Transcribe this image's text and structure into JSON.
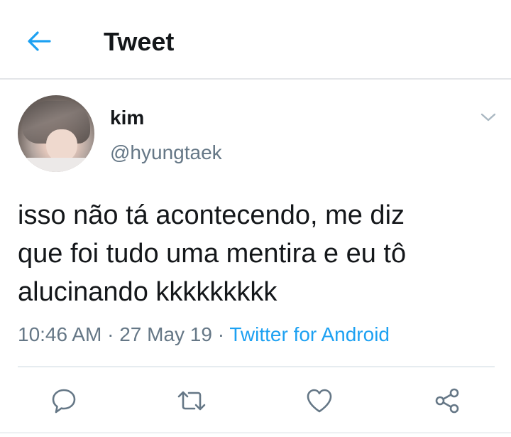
{
  "header": {
    "title": "Tweet",
    "back_icon": "arrow-left-icon"
  },
  "tweet": {
    "author": {
      "name": "kim",
      "handle": "@hyungtaek"
    },
    "text": "isso não tá acontecendo, me diz\nque foi tudo uma mentira e eu tô\nalucinando kkkkkkkkk",
    "time": "10:46 AM",
    "separator": "·",
    "date": "27 May 19",
    "source": "Twitter for Android"
  },
  "actions": [
    {
      "name": "reply",
      "icon": "reply-icon"
    },
    {
      "name": "retweet",
      "icon": "retweet-icon"
    },
    {
      "name": "like",
      "icon": "heart-icon"
    },
    {
      "name": "share",
      "icon": "share-icon"
    }
  ],
  "colors": {
    "accent": "#1da1f2",
    "secondary_text": "#657786",
    "icon": "#657786"
  }
}
